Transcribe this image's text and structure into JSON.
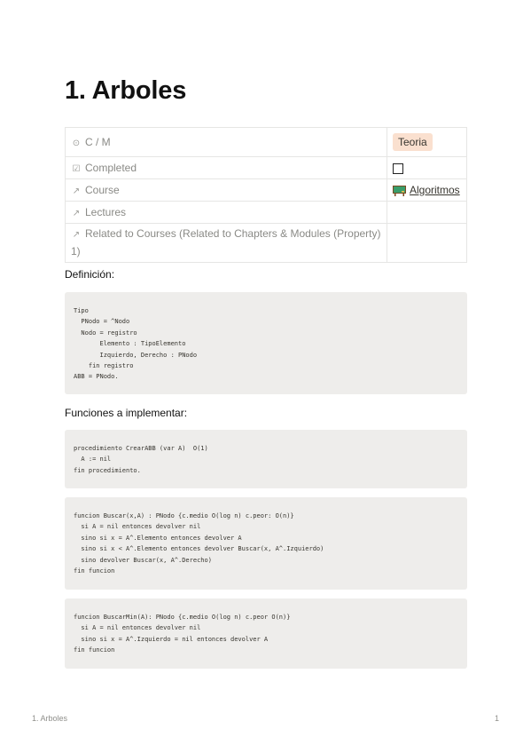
{
  "page": {
    "title": "1. Arboles"
  },
  "properties": [
    {
      "icon": "target-icon",
      "glyph": "⊙",
      "key": "C / M",
      "value_type": "tag",
      "value": "Teoria",
      "tag_color": "#fae0cf"
    },
    {
      "icon": "checkbox-icon",
      "glyph": "☑",
      "key": "Completed",
      "value_type": "checkbox",
      "value": false
    },
    {
      "icon": "arrow-up-right-icon",
      "glyph": "↗",
      "key": "Course",
      "value_type": "relation",
      "value": "Algoritmos"
    },
    {
      "icon": "arrow-up-right-icon",
      "glyph": "↗",
      "key": "Lectures",
      "value_type": "empty",
      "value": ""
    },
    {
      "icon": "arrow-up-right-icon",
      "glyph": "↗",
      "key": "Related to Courses (Related to Chapters & Modules (Property) 1)",
      "value_type": "empty",
      "value": ""
    }
  ],
  "sections": {
    "definicion": "Definición:",
    "funciones": "Funciones a implementar:"
  },
  "code_blocks": [
    "Tipo\n  PNodo = ^Nodo\n  Nodo = registro\n       Elemento : TipoElemento\n       Izquierdo, Derecho : PNodo\n    fin registro\nABB = PNodo.",
    "procedimiento CrearABB (var A)  O(1)\n  A := nil\nfin procedimiento.",
    "funcion Buscar(x,A) : PNodo {c.medio O(log n) c.peor: O(n)}\n  si A = nil entonces devolver nil\n  sino si x = A^.Elemento entonces devolver A\n  sino si x < A^.Elemento entonces devolver Buscar(x, A^.Izquierdo)\n  sino devolver Buscar(x, A^.Derecho)\nfin funcion",
    "funcion BuscarMin(A): PNodo {c.medio O(log n) c.peor O(n)}\n  si A = nil entonces devolver nil\n  sino si x = A^.Izquierdo = nil entonces devolver A\nfin funcion"
  ],
  "footer": {
    "left": "1. Arboles",
    "right": "1"
  }
}
